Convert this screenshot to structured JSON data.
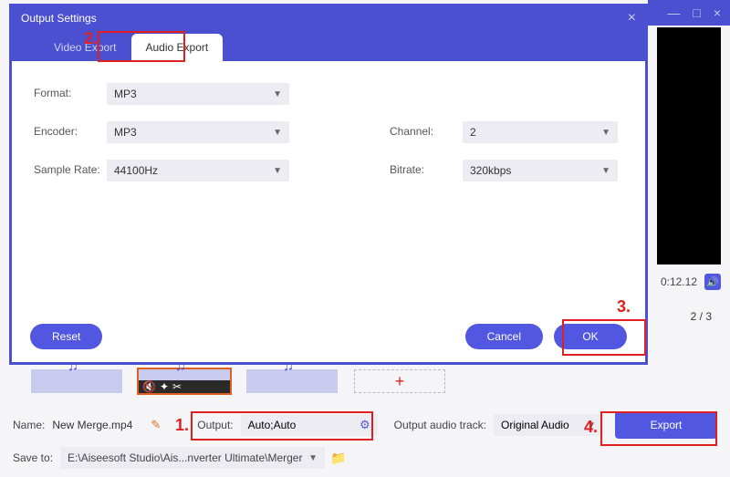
{
  "app_window": {
    "minimize": "—",
    "maximize": "□",
    "close": "×"
  },
  "dialog": {
    "title": "Output Settings",
    "close": "×",
    "tabs": {
      "video": "Video Export",
      "audio": "Audio Export"
    },
    "fields": {
      "format_label": "Format:",
      "format_value": "MP3",
      "encoder_label": "Encoder:",
      "encoder_value": "MP3",
      "channel_label": "Channel:",
      "channel_value": "2",
      "samplerate_label": "Sample Rate:",
      "samplerate_value": "44100Hz",
      "bitrate_label": "Bitrate:",
      "bitrate_value": "320kbps"
    },
    "buttons": {
      "reset": "Reset",
      "cancel": "Cancel",
      "ok": "OK"
    }
  },
  "preview": {
    "time": "0:12.12",
    "pager": "2 / 3"
  },
  "annotations": {
    "n1": "1.",
    "n2": "2.",
    "n3": "3.",
    "n4": "4."
  },
  "bottom": {
    "name_label": "Name:",
    "name_value": "New Merge.mp4",
    "output_label": "Output:",
    "output_value": "Auto;Auto",
    "track_label": "Output audio track:",
    "track_value": "Original Audio",
    "saveto_label": "Save to:",
    "saveto_value": "E:\\Aiseesoft Studio\\Ais...nverter Ultimate\\Merger",
    "export": "Export"
  }
}
